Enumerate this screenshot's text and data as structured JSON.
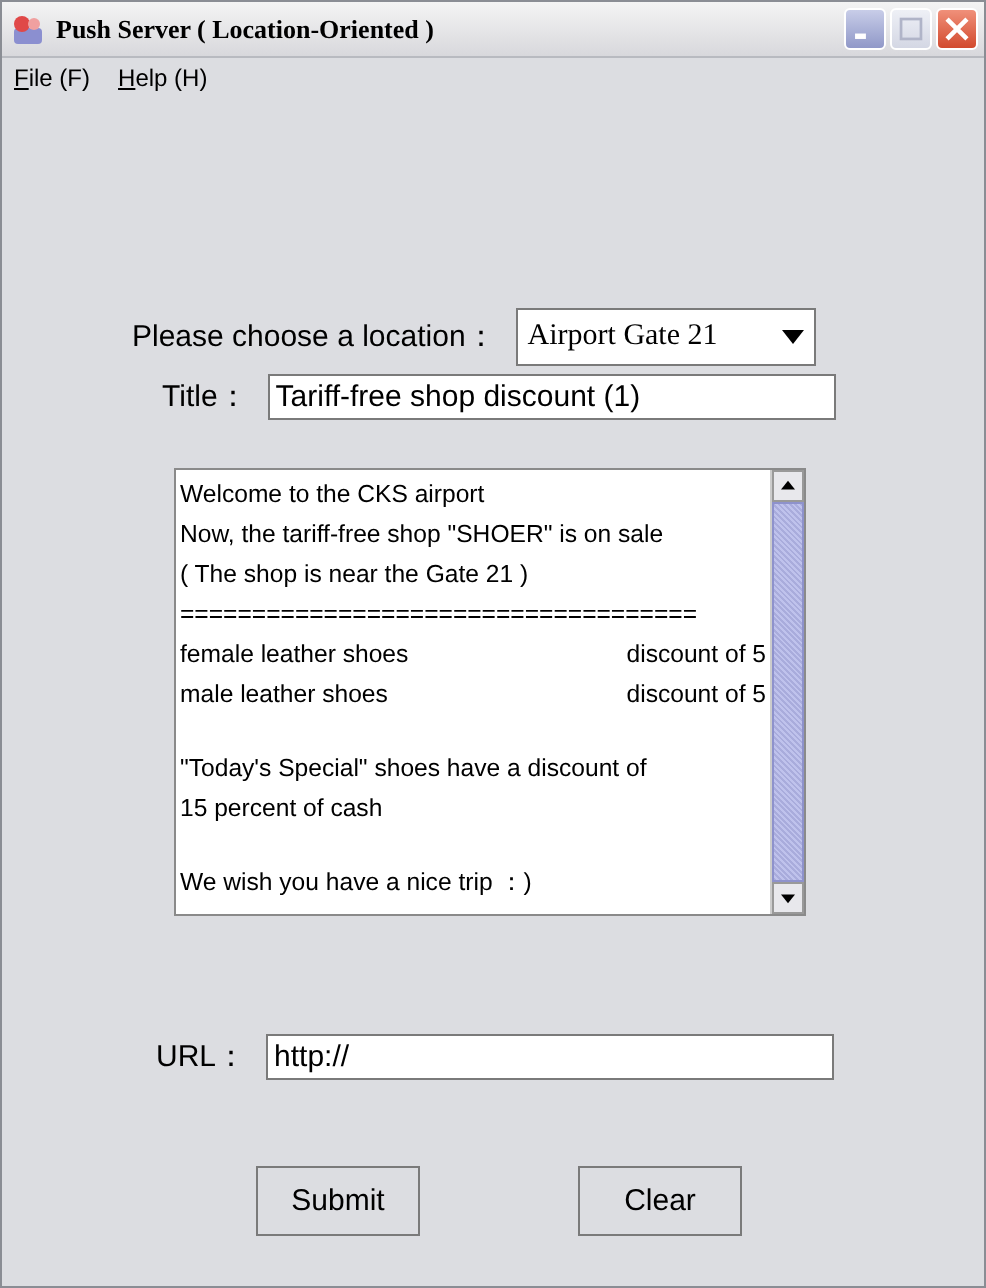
{
  "window": {
    "title": "Push Server ( Location-Oriented )"
  },
  "menu": [
    {
      "label": "File (F)"
    },
    {
      "label": "Help (H)"
    }
  ],
  "location": {
    "label": "Please choose a location：",
    "value": "Airport Gate 21"
  },
  "title_field": {
    "label": "Title：",
    "value": "Tariff-free shop discount (1)"
  },
  "message": {
    "lines": [
      {
        "kind": "text",
        "text": "Welcome to the CKS airport"
      },
      {
        "kind": "text",
        "text": "Now, the tariff-free shop \"SHOER\" is on sale"
      },
      {
        "kind": "text",
        "text": "( The shop is near the Gate 21 )"
      },
      {
        "kind": "text",
        "text": "===================================="
      },
      {
        "kind": "columns",
        "left": "female leather shoes",
        "right": "discount of 5"
      },
      {
        "kind": "columns",
        "left": "male leather shoes",
        "right": "discount of 5"
      },
      {
        "kind": "blank"
      },
      {
        "kind": "text",
        "text": "\"Today's Special\" shoes have a discount of"
      },
      {
        "kind": "text",
        "text": "15 percent of cash"
      },
      {
        "kind": "blank"
      },
      {
        "kind": "text",
        "text": "We wish you have a nice trip ：)"
      }
    ]
  },
  "url": {
    "label": "URL：",
    "value": "http://"
  },
  "buttons": [
    {
      "label": "Submit"
    },
    {
      "label": "Clear"
    }
  ]
}
